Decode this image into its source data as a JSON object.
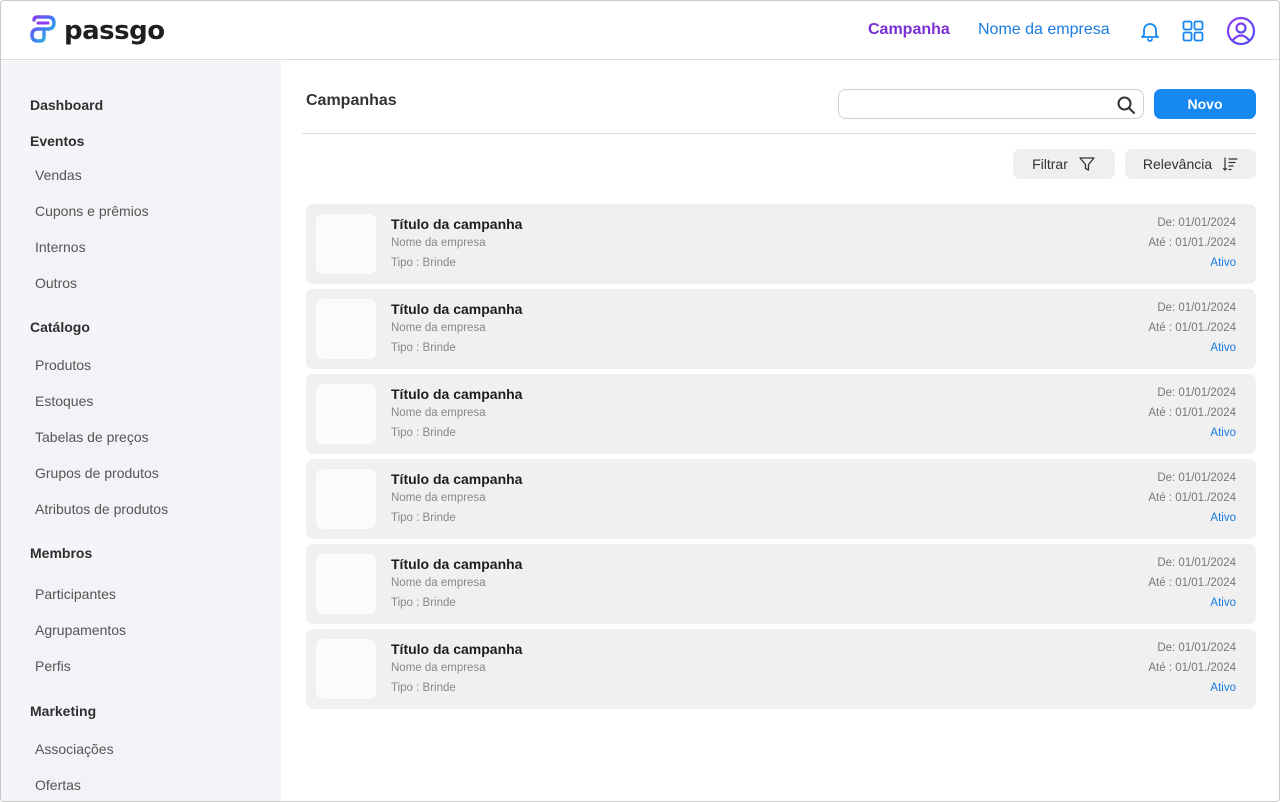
{
  "brand": {
    "name": "passgo"
  },
  "header": {
    "nav_active": "Campanha",
    "company": "Nome da empresa",
    "icons": [
      "bell-icon",
      "apps-grid-icon",
      "user-avatar-icon"
    ]
  },
  "sidebar": {
    "sections": [
      {
        "label": "Dashboard",
        "items": []
      },
      {
        "label": "Eventos",
        "items": [
          "Vendas",
          "Cupons e prêmios",
          "Internos",
          "Outros"
        ]
      },
      {
        "label": "Catálogo",
        "items": [
          "Produtos",
          "Estoques",
          "Tabelas de preços",
          "Grupos de produtos",
          "Atributos de produtos"
        ]
      },
      {
        "label": "Membros",
        "items": [
          "Participantes",
          "Agrupamentos",
          "Perfis"
        ]
      },
      {
        "label": "Marketing",
        "items": [
          "Associações",
          "Ofertas"
        ]
      }
    ]
  },
  "main": {
    "title": "Campanhas",
    "search": {
      "placeholder": "",
      "value": ""
    },
    "new_button": "Novo",
    "filter_label": "Filtrar",
    "sort_label": "Relevância",
    "cards": [
      {
        "title": "Título da campanha",
        "company": "Nome da empresa",
        "type": "Tipo : Brinde",
        "from": "De: 01/01/2024",
        "to": "Até : 01/01./2024",
        "status": "Ativo"
      },
      {
        "title": "Título da campanha",
        "company": "Nome da empresa",
        "type": "Tipo : Brinde",
        "from": "De: 01/01/2024",
        "to": "Até : 01/01./2024",
        "status": "Ativo"
      },
      {
        "title": "Título da campanha",
        "company": "Nome da empresa",
        "type": "Tipo : Brinde",
        "from": "De: 01/01/2024",
        "to": "Até : 01/01./2024",
        "status": "Ativo"
      },
      {
        "title": "Título da campanha",
        "company": "Nome da empresa",
        "type": "Tipo : Brinde",
        "from": "De: 01/01/2024",
        "to": "Até : 01/01./2024",
        "status": "Ativo"
      },
      {
        "title": "Título da campanha",
        "company": "Nome da empresa",
        "type": "Tipo : Brinde",
        "from": "De: 01/01/2024",
        "to": "Até : 01/01./2024",
        "status": "Ativo"
      },
      {
        "title": "Título da campanha",
        "company": "Nome da empresa",
        "type": "Tipo : Brinde",
        "from": "De: 01/01/2024",
        "to": "Até : 01/01./2024",
        "status": "Ativo"
      }
    ]
  },
  "colors": {
    "accent_purple": "#7b2fd6",
    "accent_blue": "#1787f2",
    "link_blue": "#1b7be0",
    "sidebar_bg": "#f3f5f8",
    "card_bg": "#f0f0f0"
  }
}
